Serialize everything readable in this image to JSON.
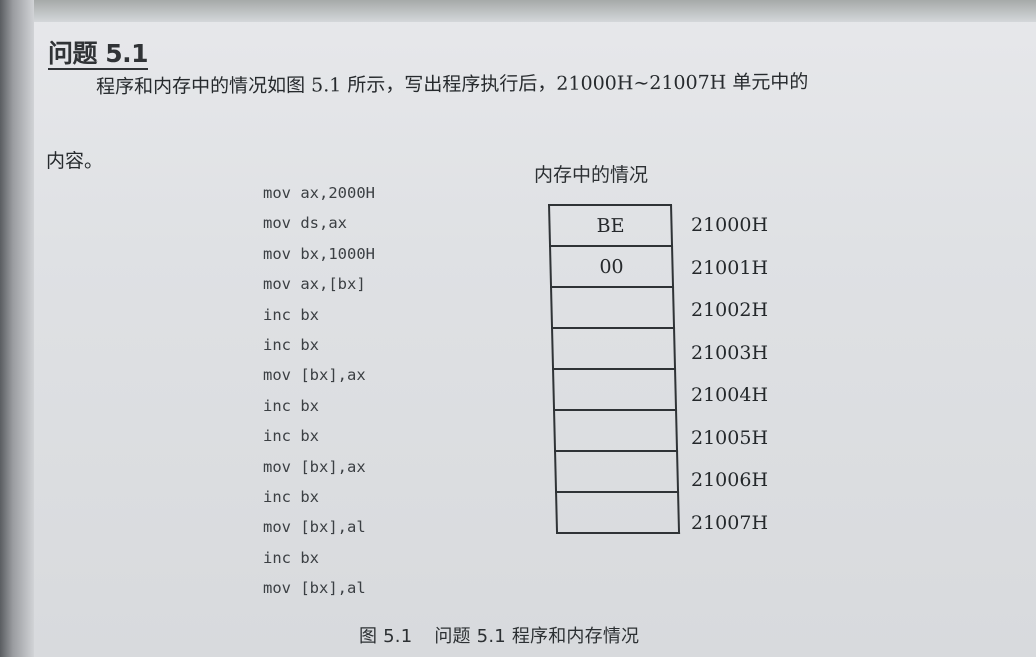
{
  "title": "问题 5.1",
  "paragraph": {
    "line1": "程序和内存中的情况如图 5.1 所示，写出程序执行后，21000H~21007H 单元中的",
    "line2": "内容。"
  },
  "code_lines": [
    "mov ax,2000H",
    "mov ds,ax",
    "mov bx,1000H",
    "mov ax,[bx]",
    "inc bx",
    "inc bx",
    "mov [bx],ax",
    "inc bx",
    "inc bx",
    "mov [bx],ax",
    "inc bx",
    "mov [bx],al",
    "inc bx",
    "mov [bx],al"
  ],
  "memory": {
    "title": "内存中的情况",
    "cells": [
      {
        "value": "BE",
        "address": "21000H"
      },
      {
        "value": "00",
        "address": "21001H"
      },
      {
        "value": "",
        "address": "21002H"
      },
      {
        "value": "",
        "address": "21003H"
      },
      {
        "value": "",
        "address": "21004H"
      },
      {
        "value": "",
        "address": "21005H"
      },
      {
        "value": "",
        "address": "21006H"
      },
      {
        "value": "",
        "address": "21007H"
      }
    ]
  },
  "caption": {
    "number": "图 5.1",
    "text": "问题 5.1 程序和内存情况"
  }
}
